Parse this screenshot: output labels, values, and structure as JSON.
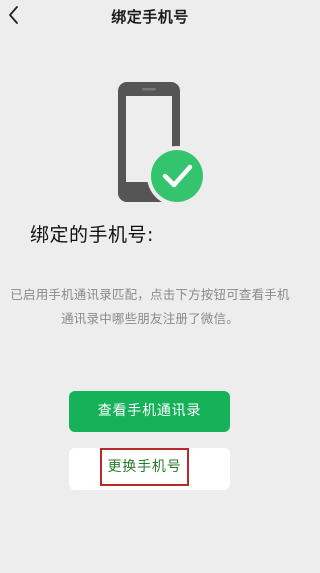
{
  "header": {
    "title": "绑定手机号",
    "back_icon": "back-chevron-icon"
  },
  "illustration": {
    "phone_icon": "smartphone-icon",
    "check_icon": "check-badge-icon",
    "check_color": "#34c46e",
    "phone_color": "#555555"
  },
  "main": {
    "heading": "绑定的手机号:",
    "description": "已启用手机通讯录匹配，点击下方按钮可查看手机通讯录中哪些朋友注册了微信。"
  },
  "actions": {
    "view_contacts_label": "查看手机通讯录",
    "change_phone_label": "更换手机号"
  },
  "colors": {
    "accent": "#15b25a",
    "background": "#ededed",
    "highlight_border": "#b52a2a",
    "link_text": "#2b7a2b"
  }
}
